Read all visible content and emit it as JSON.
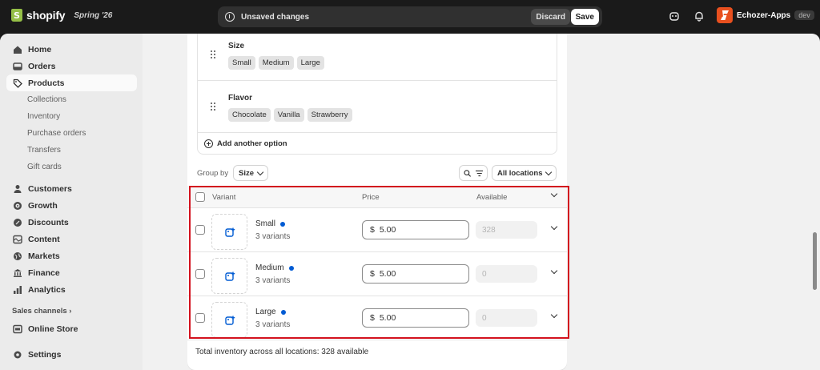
{
  "topbar": {
    "logo_text": "shopify",
    "edition": "Spring '26",
    "unsaved_text": "Unsaved changes",
    "discard_label": "Discard",
    "save_label": "Save",
    "store_name": "Echozer-Apps",
    "store_env": "dev"
  },
  "sidebar": {
    "items": [
      {
        "label": "Home",
        "icon": "home-icon"
      },
      {
        "label": "Orders",
        "icon": "inbox-icon"
      },
      {
        "label": "Products",
        "icon": "tag-icon",
        "active": true
      },
      {
        "label": "Customers",
        "icon": "person-icon"
      },
      {
        "label": "Growth",
        "icon": "target-icon"
      },
      {
        "label": "Discounts",
        "icon": "discount-icon"
      },
      {
        "label": "Content",
        "icon": "content-icon"
      },
      {
        "label": "Markets",
        "icon": "globe-icon"
      },
      {
        "label": "Finance",
        "icon": "bank-icon"
      },
      {
        "label": "Analytics",
        "icon": "chart-icon"
      },
      {
        "label": "Online Store",
        "icon": "store-icon"
      },
      {
        "label": "Settings",
        "icon": "gear-icon"
      }
    ],
    "subitems": [
      "Collections",
      "Inventory",
      "Purchase orders",
      "Transfers",
      "Gift cards"
    ],
    "sales_channels_label": "Sales channels"
  },
  "options": [
    {
      "name": "Size",
      "values": [
        "Small",
        "Medium",
        "Large"
      ]
    },
    {
      "name": "Flavor",
      "values": [
        "Chocolate",
        "Vanilla",
        "Strawberry"
      ]
    }
  ],
  "add_option_label": "Add another option",
  "group_by": {
    "label": "Group by",
    "value": "Size",
    "locations_label": "All locations"
  },
  "table": {
    "headers": {
      "variant": "Variant",
      "price": "Price",
      "available": "Available"
    },
    "rows": [
      {
        "name": "Small",
        "count": "3 variants",
        "currency": "$",
        "price": "5.00",
        "available": "328"
      },
      {
        "name": "Medium",
        "count": "3 variants",
        "currency": "$",
        "price": "5.00",
        "available": "0"
      },
      {
        "name": "Large",
        "count": "3 variants",
        "currency": "$",
        "price": "5.00",
        "available": "0"
      }
    ],
    "total": "Total inventory across all locations: 328 available"
  },
  "colors": {
    "highlight": "#d3121e",
    "accent_dot": "#005bd3",
    "topbar_bg": "#1a1a1a"
  }
}
